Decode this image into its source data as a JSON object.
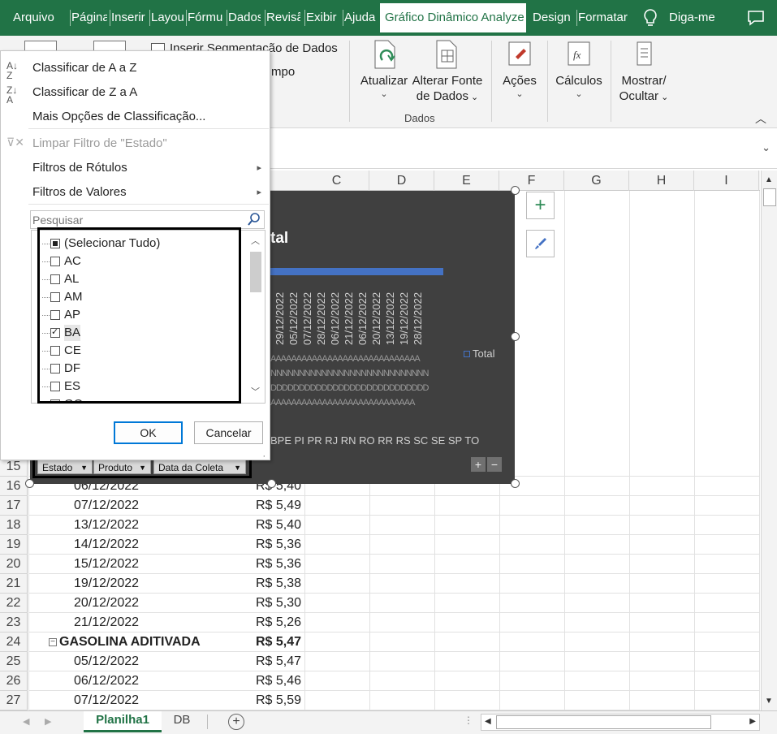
{
  "tabs": [
    {
      "label": "Arquivo",
      "active": false
    },
    {
      "label": "Página",
      "active": false
    },
    {
      "label": "Inserir",
      "active": false
    },
    {
      "label": "Layou",
      "active": false
    },
    {
      "label": "Fórmu",
      "active": false
    },
    {
      "label": "Dados",
      "active": false
    },
    {
      "label": "Revisã",
      "active": false
    },
    {
      "label": "Exibir",
      "active": false
    },
    {
      "label": "Ajuda",
      "active": false
    },
    {
      "label": "Gráfico Dinâmico Analyze",
      "active": true
    },
    {
      "label": "Design",
      "active": false
    },
    {
      "label": "Formatar",
      "active": false
    }
  ],
  "tell_me": "Diga-me",
  "ribbon": {
    "insert_slicer": "Inserir Segmentação de Dados",
    "timeline_partial": "mpo",
    "refresh": "Atualizar",
    "change_source_line1": "Alterar Fonte",
    "change_source_line2": "de Dados",
    "group_dados": "Dados",
    "acoes": "Ações",
    "calculos": "Cálculos",
    "mostrar_line1": "Mostrar/",
    "mostrar_line2": "Ocultar"
  },
  "columns": [
    "C",
    "D",
    "E",
    "F",
    "G",
    "H",
    "I"
  ],
  "rows": [
    {
      "num": "15",
      "a": "",
      "b": "",
      "bold": false
    },
    {
      "num": "16",
      "a": "06/12/2022",
      "b": "R$ 5,40",
      "bold": false
    },
    {
      "num": "17",
      "a": "07/12/2022",
      "b": "R$ 5,49",
      "bold": false
    },
    {
      "num": "18",
      "a": "13/12/2022",
      "b": "R$ 5,40",
      "bold": false
    },
    {
      "num": "19",
      "a": "14/12/2022",
      "b": "R$ 5,36",
      "bold": false
    },
    {
      "num": "20",
      "a": "15/12/2022",
      "b": "R$ 5,36",
      "bold": false
    },
    {
      "num": "21",
      "a": "19/12/2022",
      "b": "R$ 5,38",
      "bold": false
    },
    {
      "num": "22",
      "a": "20/12/2022",
      "b": "R$ 5,30",
      "bold": false
    },
    {
      "num": "23",
      "a": "21/12/2022",
      "b": "R$ 5,26",
      "bold": false
    },
    {
      "num": "24",
      "a": "GASOLINA ADITIVADA",
      "b": "R$ 5,47",
      "bold": true
    },
    {
      "num": "25",
      "a": "05/12/2022",
      "b": "R$ 5,47",
      "bold": false
    },
    {
      "num": "26",
      "a": "06/12/2022",
      "b": "R$ 5,46",
      "bold": false
    },
    {
      "num": "27",
      "a": "07/12/2022",
      "b": "R$ 5,59",
      "bold": false
    }
  ],
  "chart": {
    "title_partial": "tal",
    "legend": "Total",
    "date_labels": [
      "29/12/2022",
      "05/12/2022",
      "07/12/2022",
      "28/12/2022",
      "06/12/2022",
      "21/12/2022",
      "06/12/2022",
      "20/12/2022",
      "13/12/2022",
      "19/12/2022",
      "28/12/2022"
    ],
    "state_labels": "BPE PI PR RJ RN RO RR RS SC SE SP TO",
    "field_buttons": [
      "Estado",
      "Produto",
      "Data da Coleta"
    ]
  },
  "filter_menu": {
    "sort_az": "Classificar de A a Z",
    "sort_za": "Classificar de Z a A",
    "more_sort": "Mais Opções de Classificação...",
    "clear_filter": "Limpar Filtro de \"Estado\"",
    "label_filters": "Filtros de Rótulos",
    "value_filters": "Filtros de Valores",
    "search_placeholder": "Pesquisar",
    "items": [
      {
        "label": "(Selecionar Tudo)",
        "state": "partial"
      },
      {
        "label": "AC",
        "state": "unchecked"
      },
      {
        "label": "AL",
        "state": "unchecked"
      },
      {
        "label": "AM",
        "state": "unchecked"
      },
      {
        "label": "AP",
        "state": "unchecked"
      },
      {
        "label": "BA",
        "state": "checked"
      },
      {
        "label": "CE",
        "state": "unchecked"
      },
      {
        "label": "DF",
        "state": "unchecked"
      },
      {
        "label": "ES",
        "state": "unchecked"
      },
      {
        "label": "GO",
        "state": "unchecked"
      }
    ],
    "ok": "OK",
    "cancel": "Cancelar"
  },
  "sheets": [
    {
      "label": "Planilha1",
      "active": true
    },
    {
      "label": "DB",
      "active": false
    }
  ]
}
